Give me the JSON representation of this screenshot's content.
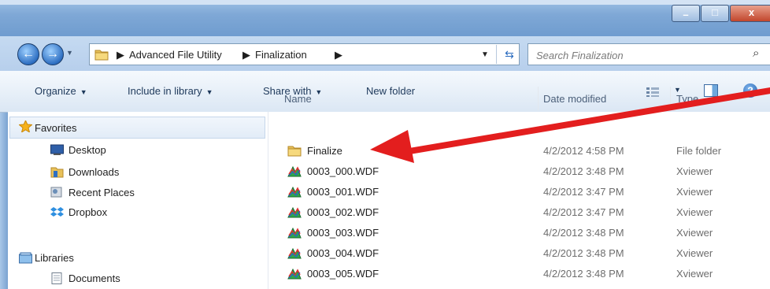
{
  "window": {
    "controls": {
      "minimize": "–",
      "maximize": "□",
      "close": "x"
    }
  },
  "nav": {
    "back": "←",
    "forward": "→",
    "history_dropdown": "▼",
    "breadcrumb": [
      "Advanced File Utility",
      "Finalization"
    ],
    "separator": "▶",
    "address_dropdown": "▼",
    "refresh": "⇆",
    "search_placeholder": "Search Finalization",
    "search_icon": "⌕"
  },
  "toolbar": {
    "organize": "Organize",
    "include": "Include in library",
    "share": "Share with",
    "new_folder": "New folder",
    "dropdown_arrow": "▼",
    "help": "?"
  },
  "sidebar": {
    "favorites": "Favorites",
    "items": [
      "Desktop",
      "Downloads",
      "Recent Places",
      "Dropbox"
    ],
    "libraries": "Libraries",
    "library_items": [
      "Documents"
    ]
  },
  "columns": {
    "name": "Name",
    "date": "Date modified",
    "type": "Type"
  },
  "files": [
    {
      "name": "Finalize",
      "date": "4/2/2012 4:58 PM",
      "type": "File folder",
      "icon": "folder-icon"
    },
    {
      "name": "0003_000.WDF",
      "date": "4/2/2012 3:48 PM",
      "type": "Xviewer",
      "icon": "wdf-file-icon"
    },
    {
      "name": "0003_001.WDF",
      "date": "4/2/2012 3:47 PM",
      "type": "Xviewer",
      "icon": "wdf-file-icon"
    },
    {
      "name": "0003_002.WDF",
      "date": "4/2/2012 3:47 PM",
      "type": "Xviewer",
      "icon": "wdf-file-icon"
    },
    {
      "name": "0003_003.WDF",
      "date": "4/2/2012 3:48 PM",
      "type": "Xviewer",
      "icon": "wdf-file-icon"
    },
    {
      "name": "0003_004.WDF",
      "date": "4/2/2012 3:48 PM",
      "type": "Xviewer",
      "icon": "wdf-file-icon"
    },
    {
      "name": "0003_005.WDF",
      "date": "4/2/2012 3:48 PM",
      "type": "Xviewer",
      "icon": "wdf-file-icon"
    }
  ],
  "colors": {
    "annotation_arrow": "#e31e1e",
    "title_bar": "#7fa8d6",
    "close_button": "#c2462c"
  }
}
